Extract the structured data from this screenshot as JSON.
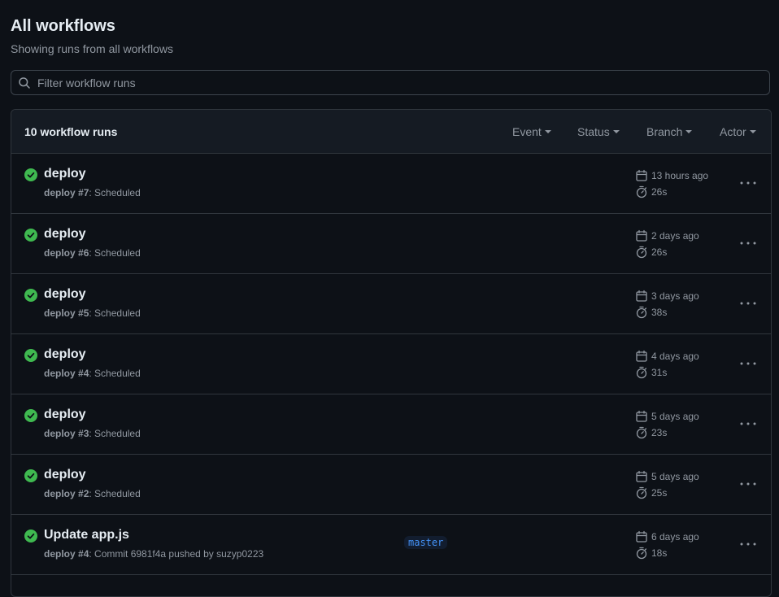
{
  "header": {
    "title": "All workflows",
    "subtitle": "Showing runs from all workflows"
  },
  "search": {
    "placeholder": "Filter workflow runs",
    "value": ""
  },
  "runs_header": {
    "count_label": "10 workflow runs",
    "filters": [
      "Event",
      "Status",
      "Branch",
      "Actor"
    ]
  },
  "colors": {
    "success": "#3fb950",
    "muted": "#9198a1",
    "branch_badge": "#4493f8"
  },
  "runs": [
    {
      "title": "deploy",
      "workflow": "deploy",
      "run_number": "#7",
      "detail": ": Scheduled",
      "branch": "",
      "when": "13 hours ago",
      "duration": "26s",
      "status": "success"
    },
    {
      "title": "deploy",
      "workflow": "deploy",
      "run_number": "#6",
      "detail": ": Scheduled",
      "branch": "",
      "when": "2 days ago",
      "duration": "26s",
      "status": "success"
    },
    {
      "title": "deploy",
      "workflow": "deploy",
      "run_number": "#5",
      "detail": ": Scheduled",
      "branch": "",
      "when": "3 days ago",
      "duration": "38s",
      "status": "success"
    },
    {
      "title": "deploy",
      "workflow": "deploy",
      "run_number": "#4",
      "detail": ": Scheduled",
      "branch": "",
      "when": "4 days ago",
      "duration": "31s",
      "status": "success"
    },
    {
      "title": "deploy",
      "workflow": "deploy",
      "run_number": "#3",
      "detail": ": Scheduled",
      "branch": "",
      "when": "5 days ago",
      "duration": "23s",
      "status": "success"
    },
    {
      "title": "deploy",
      "workflow": "deploy",
      "run_number": "#2",
      "detail": ": Scheduled",
      "branch": "",
      "when": "5 days ago",
      "duration": "25s",
      "status": "success"
    },
    {
      "title": "Update app.js",
      "workflow": "deploy",
      "run_number": "#4",
      "detail": ": Commit 6981f4a pushed by suzyp0223",
      "branch": "master",
      "when": "6 days ago",
      "duration": "18s",
      "status": "success"
    }
  ]
}
